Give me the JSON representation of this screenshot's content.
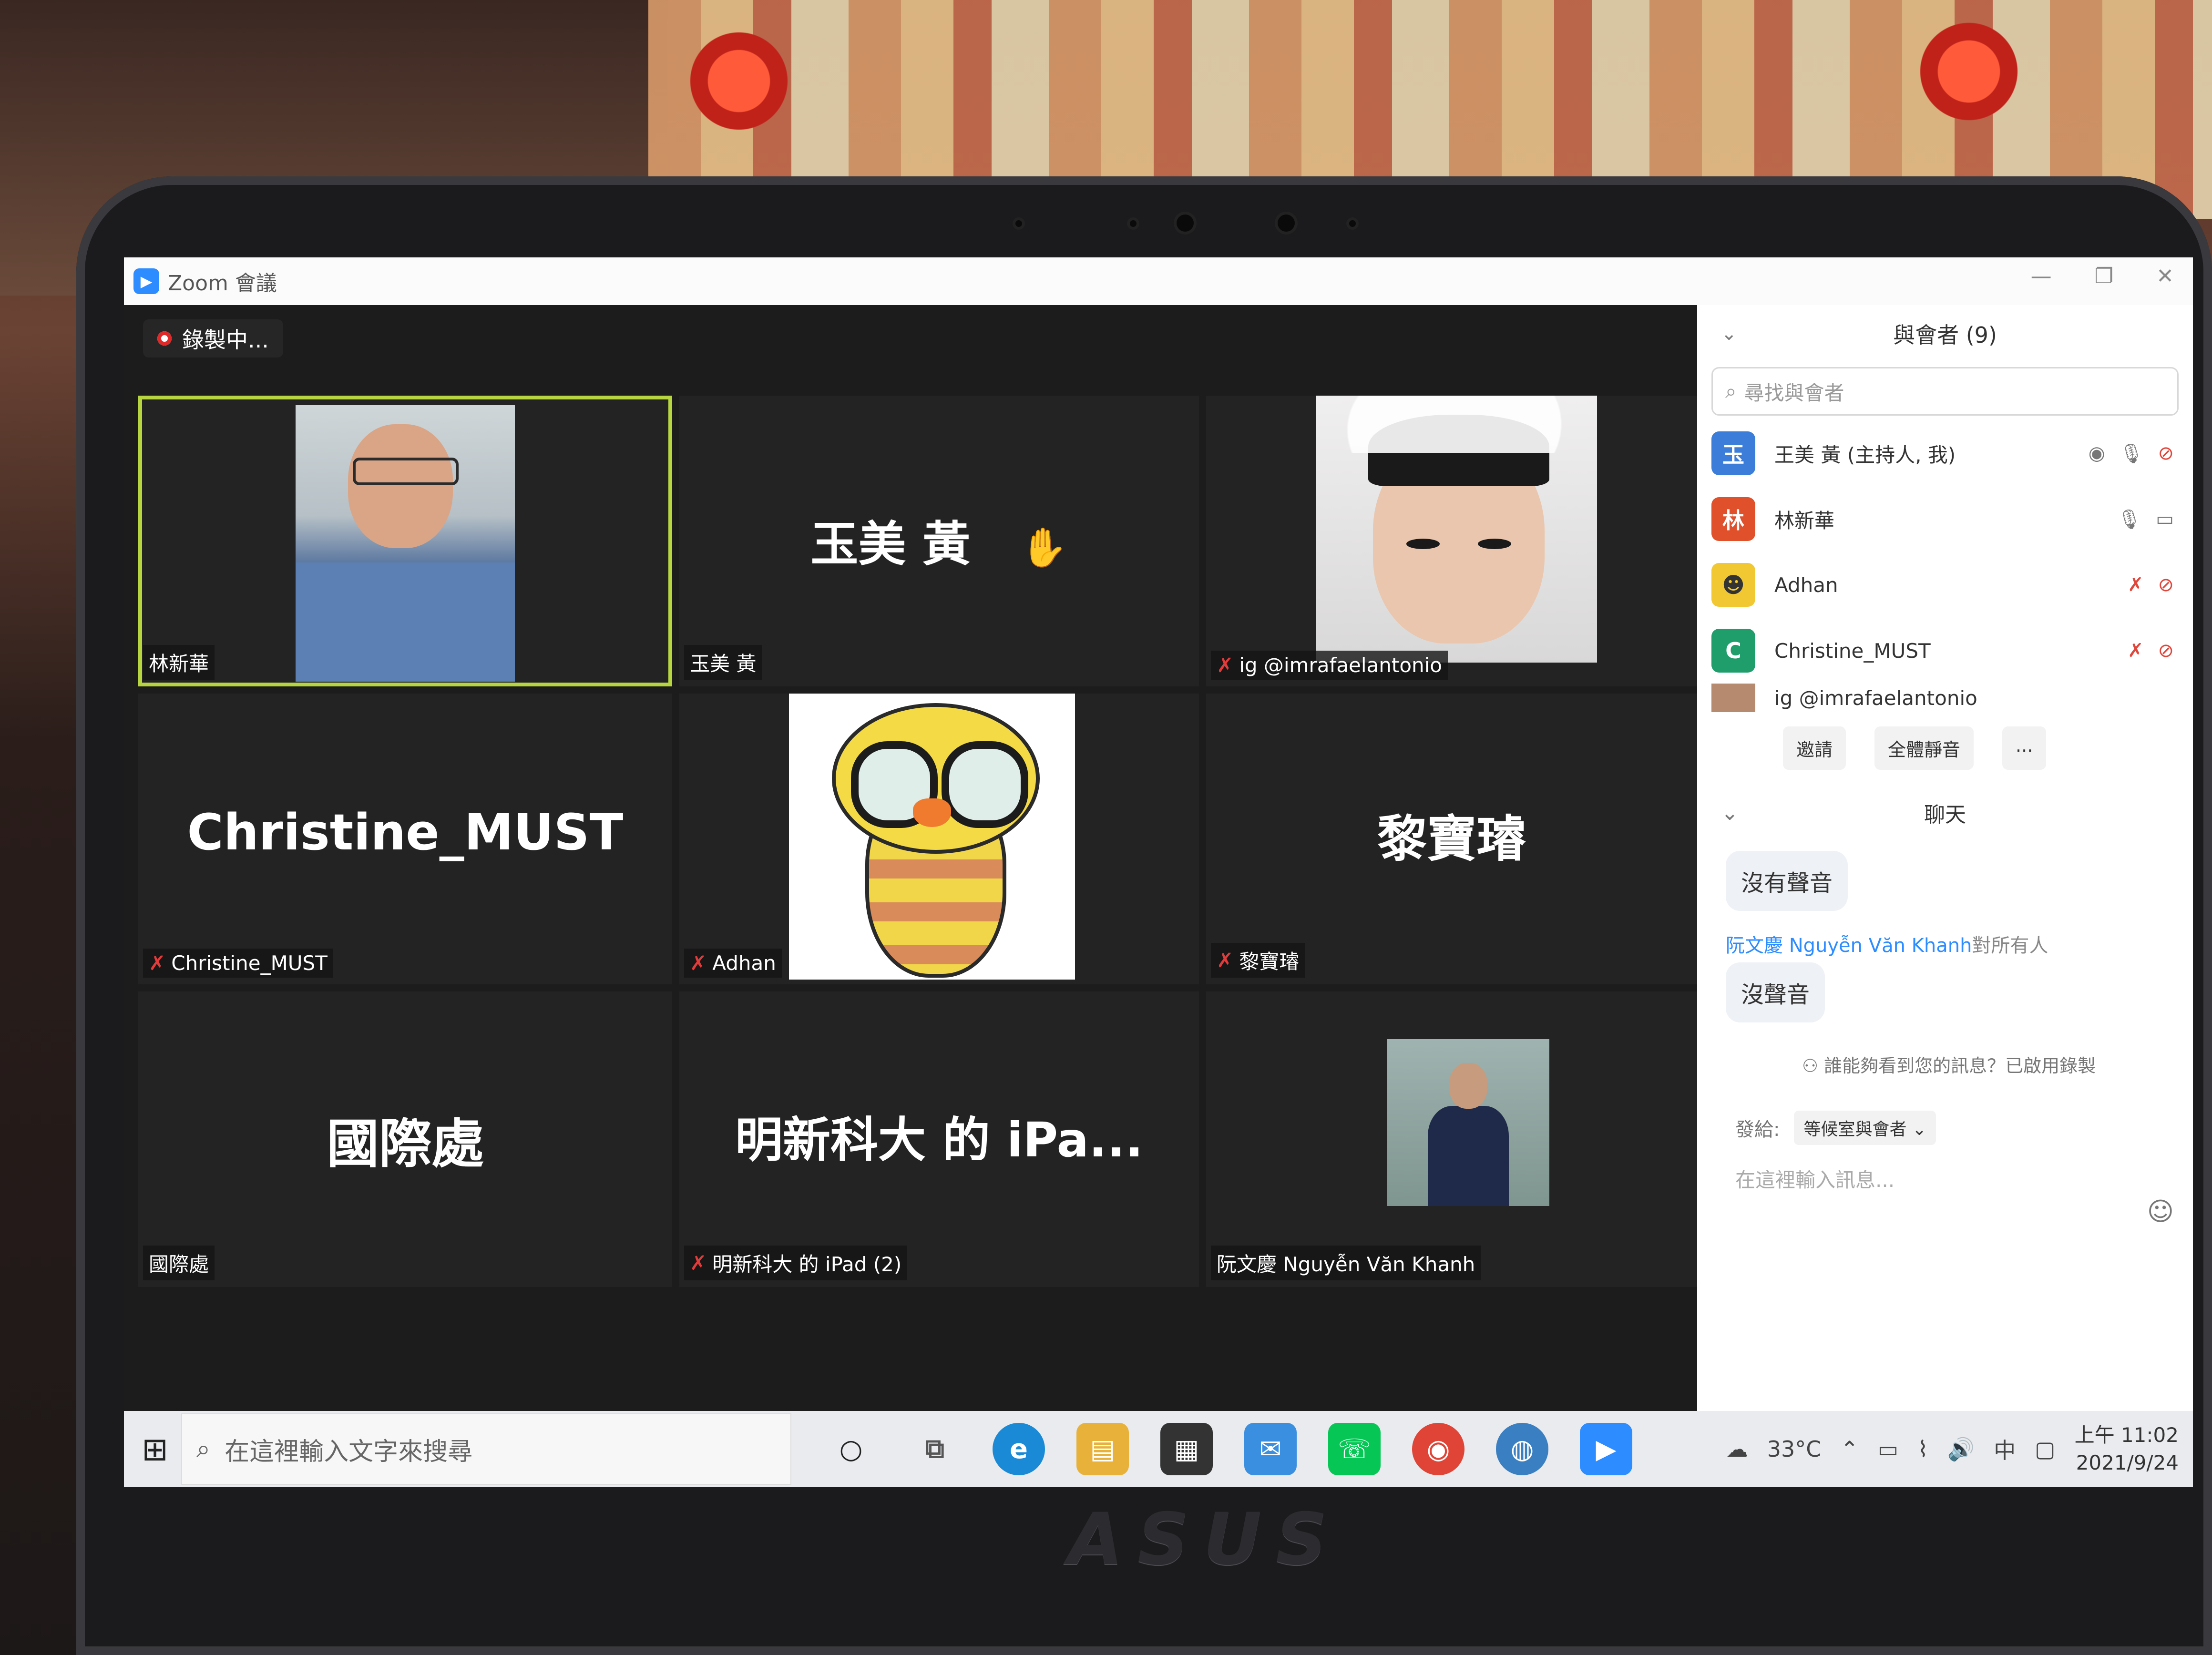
{
  "window": {
    "title": "Zoom 會議"
  },
  "recording": {
    "label": "錄製中..."
  },
  "tiles": [
    {
      "label": "林新華"
    },
    {
      "display_name": "玉美 黃",
      "label": "玉美 黃"
    },
    {
      "label": "ig @imrafaelantonio"
    },
    {
      "display_name": "Christine_MUST",
      "label": "Christine_MUST"
    },
    {
      "label": "Adhan"
    },
    {
      "display_name": "黎寶璿",
      "label": "黎寶璿"
    },
    {
      "display_name": "國際處",
      "label": "國際處"
    },
    {
      "display_name": "明新科大 的 iPa...",
      "label": "明新科大 的 iPad (2)"
    },
    {
      "label": "阮文慶 Nguyễn Văn Khanh"
    }
  ],
  "participants_panel": {
    "title": "與會者 (9)",
    "search_placeholder": "尋找與會者",
    "items": [
      {
        "avatar": "玉",
        "name": "王美 黃 (主持人, 我)",
        "color": "#3b7dd8"
      },
      {
        "avatar": "林",
        "name": "林新華",
        "color": "#e0502a"
      },
      {
        "avatar": "",
        "name": "Adhan",
        "color": "#f2c832"
      },
      {
        "avatar": "C",
        "name": "Christine_MUST",
        "color": "#1f9e6b"
      },
      {
        "avatar": "",
        "name": "ig @imrafaelantonio",
        "color": "#b58a6e"
      }
    ],
    "invite_label": "邀請",
    "mute_all_label": "全體靜音",
    "more_label": "..."
  },
  "chat_panel": {
    "title": "聊天",
    "messages": [
      {
        "text": "沒有聲音"
      },
      {
        "from": "阮文慶 Nguyễn Văn Khanh",
        "to": "對所有人",
        "text": "沒聲音"
      }
    ],
    "privacy_note": "誰能夠看到您的訊息？已啟用錄製",
    "send_to_label": "發給:",
    "send_to_value": "等候室與會者",
    "input_placeholder": "在這裡輸入訊息..."
  },
  "taskbar": {
    "search_placeholder": "在這裡輸入文字來搜尋",
    "weather": "33°C",
    "ime": "中",
    "time": "上午 11:02",
    "date": "2021/9/24"
  },
  "hardware": {
    "brand": "ASUS"
  }
}
